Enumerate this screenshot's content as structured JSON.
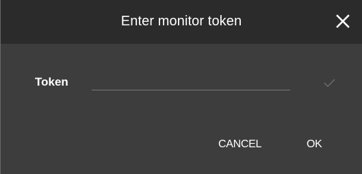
{
  "dialog": {
    "title": "Enter monitor token",
    "close_icon": "close-icon",
    "token_label": "Token",
    "token_value": "",
    "token_placeholder": "",
    "check_icon": "checkmark-icon",
    "cancel_label": "CANCEL",
    "ok_label": "OK"
  },
  "colors": {
    "titlebar_bg": "#2b2b2b",
    "body_bg": "#3d3d3d",
    "text": "#ffffff",
    "check_disabled": "#6f6f6f"
  }
}
